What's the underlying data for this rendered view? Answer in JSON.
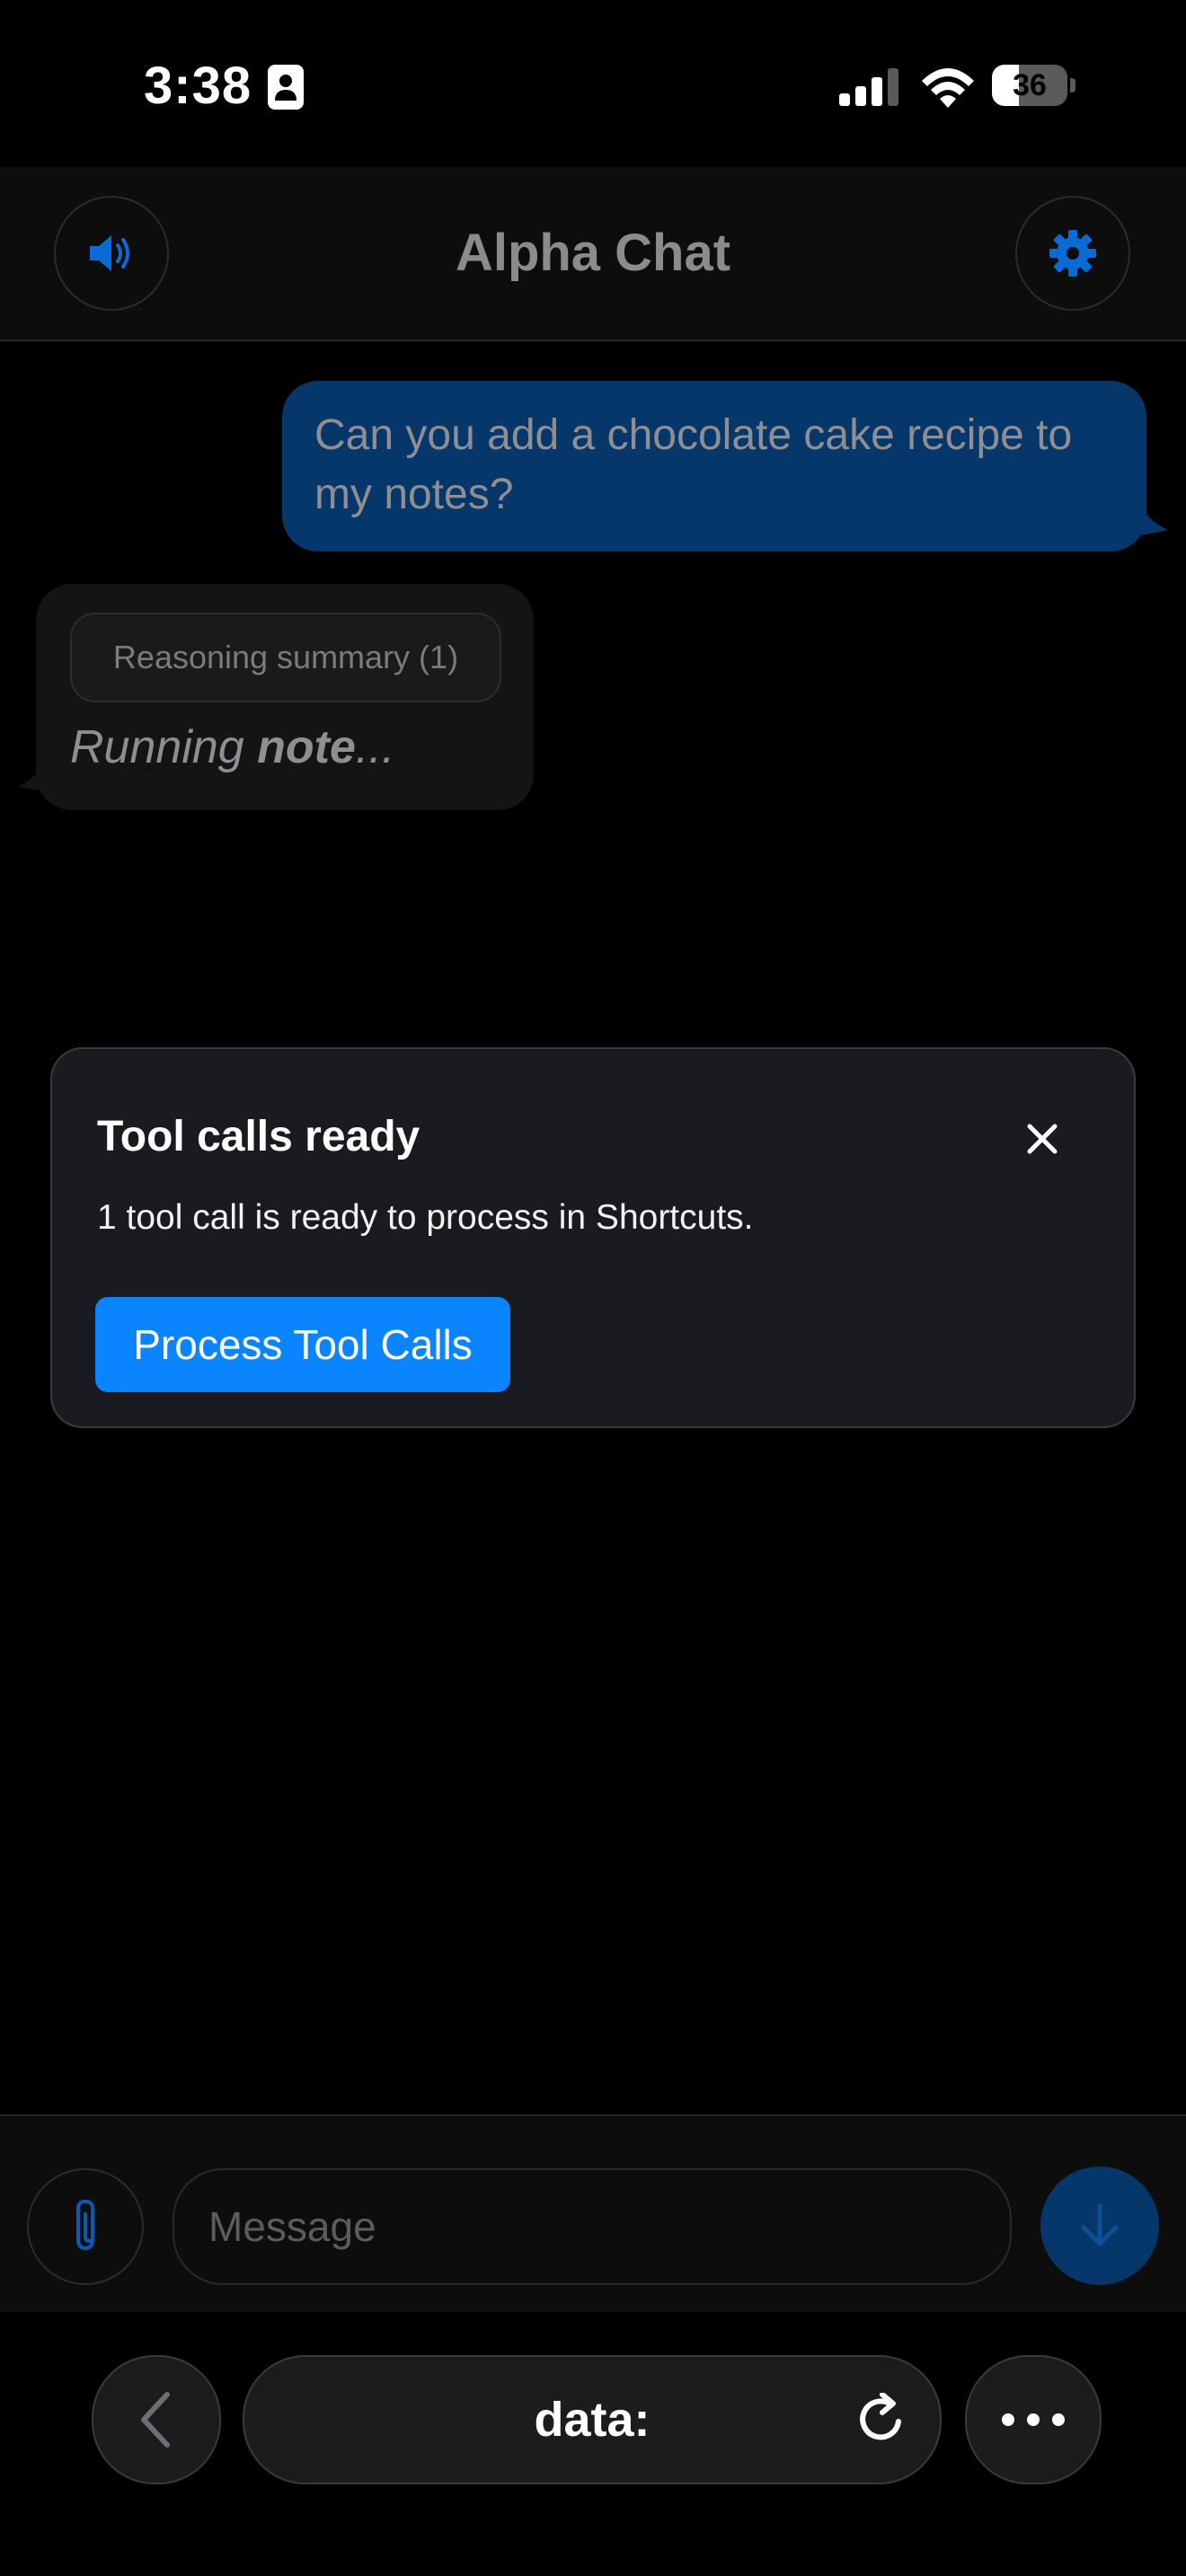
{
  "status_bar": {
    "time": "3:38",
    "battery_percent": "36",
    "battery_level": 0.36
  },
  "header": {
    "title": "Alpha Chat",
    "left_icon": "speaker-icon",
    "right_icon": "gear-icon"
  },
  "messages": [
    {
      "role": "user",
      "text": "Can you add a chocolate cake recipe to my notes?"
    },
    {
      "role": "assistant",
      "reasoning_label": "Reasoning summary (1)",
      "status_prefix": "Running ",
      "status_tool": "note",
      "status_suffix": "..."
    }
  ],
  "tool_dialog": {
    "title": "Tool calls ready",
    "body": "1 tool call is ready to process in Shortcuts.",
    "button_label": "Process Tool Calls",
    "close_icon": "close-icon"
  },
  "composer": {
    "placeholder": "Message",
    "value": "",
    "attach_icon": "paperclip-icon",
    "send_icon": "arrow-down-icon"
  },
  "browser": {
    "address": "data:",
    "back_icon": "chevron-left-icon",
    "reload_icon": "reload-icon",
    "more_icon": "ellipsis-icon"
  },
  "colors": {
    "accent": "#0a84ff",
    "user_bubble": "#06376a",
    "background": "#000000"
  }
}
